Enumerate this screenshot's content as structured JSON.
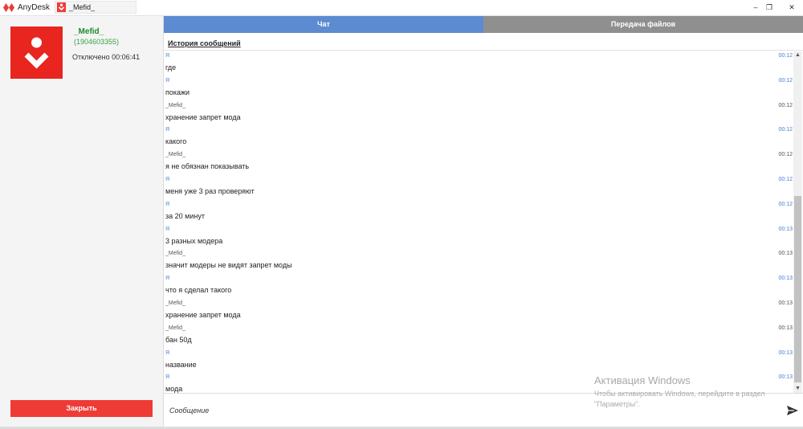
{
  "app": {
    "name": "AnyDesk",
    "session_tab": "_Mefid_"
  },
  "window_controls": {
    "minimize": "–",
    "maximize": "❐",
    "close": "✕"
  },
  "peer": {
    "name": "_Mefid_",
    "id": "(1904603355)",
    "status": "Отключено 00:06:41"
  },
  "left_panel": {
    "close_label": "Закрыть"
  },
  "tabs": {
    "chat": "Чат",
    "files": "Передача файлов"
  },
  "history_title": "История сообщений",
  "messages": [
    {
      "sender": "Я",
      "time": "00:12",
      "text": "где",
      "me": true
    },
    {
      "sender": "Я",
      "time": "00:12",
      "text": "покажи",
      "me": true
    },
    {
      "sender": "_Mefid_",
      "time": "00:12",
      "text": "хранение запрет мода",
      "me": false
    },
    {
      "sender": "Я",
      "time": "00:12",
      "text": "какого",
      "me": true
    },
    {
      "sender": "_Mefid_",
      "time": "00:12",
      "text": "я не обязнан показывать",
      "me": false
    },
    {
      "sender": "Я",
      "time": "00:12",
      "text": "меня уже 3 раз проверяют",
      "me": true
    },
    {
      "sender": "Я",
      "time": "00:12",
      "text": "за 20 минут",
      "me": true
    },
    {
      "sender": "Я",
      "time": "00:13",
      "text": "3 разных модера",
      "me": true
    },
    {
      "sender": "_Mefid_",
      "time": "00:13",
      "text": "значит модеры не видят запрет моды",
      "me": false
    },
    {
      "sender": "Я",
      "time": "00:13",
      "text": "что я сделал такого",
      "me": true
    },
    {
      "sender": "_Mefid_",
      "time": "00:13",
      "text": "хранение запрет мода",
      "me": false
    },
    {
      "sender": "_Mefid_",
      "time": "00:13",
      "text": "бан 50д",
      "me": false
    },
    {
      "sender": "Я",
      "time": "00:13",
      "text": "название",
      "me": true
    },
    {
      "sender": "Я",
      "time": "00:13",
      "text": "мода",
      "me": true
    }
  ],
  "input": {
    "placeholder": "Сообщение"
  },
  "watermark": {
    "title": "Активация Windows",
    "subtitle": "Чтобы активировать Windows, перейдите в раздел \"Параметры\"."
  },
  "colors": {
    "accent_red": "#ef3b36",
    "chat_tab": "#5c8bd1",
    "files_tab": "#8f8f8f",
    "peer_green": "#1b8c2a",
    "my_sender": "#4a7fd0"
  },
  "icons": {
    "app_logo": "anydesk-logo-icon",
    "avatar": "anydesk-avatar-icon",
    "send": "send-icon",
    "scroll_up": "chevron-up-icon",
    "scroll_down": "chevron-down-icon"
  }
}
